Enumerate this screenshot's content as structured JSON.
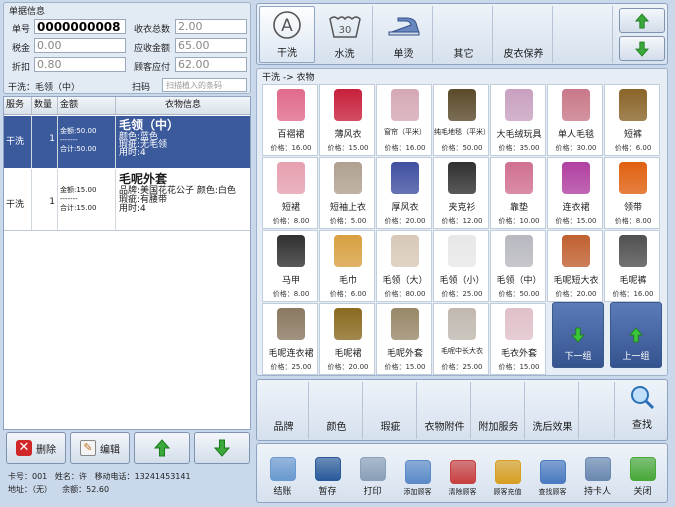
{
  "order_info": {
    "title": "单据信息",
    "order_no_label": "单号",
    "order_no": "0000000008",
    "total_label": "收衣总数",
    "total": "2.00",
    "tax_label": "税金",
    "tax": "0.00",
    "receivable_label": "应收金额",
    "receivable": "65.00",
    "discount_label": "折扣",
    "discount": "0.80",
    "payable_label": "顾客应付",
    "payable": "62.00",
    "current_item": "干洗：毛领（中）",
    "scan_label": "扫码",
    "scan_placeholder": "扫描植入的条码"
  },
  "orders": {
    "columns": [
      "服务",
      "数量",
      "金额",
      "衣物信息"
    ],
    "rows": [
      {
        "service": "干洗",
        "qty": "1",
        "amount": "金额:50.00",
        "sep": "-------",
        "subtotal": "合计:50.00",
        "name": "毛领（中）",
        "d1": "颜色:蓝色",
        "d2": "瑕疵:无毛领",
        "d3": "用时:4"
      },
      {
        "service": "干洗",
        "qty": "1",
        "amount": "金额:15.00",
        "sep": "-------",
        "subtotal": "合计:15.00",
        "name": "毛呢外套",
        "d1": "品牌:美国花花公子 颜色:白色",
        "d2": "瑕疵:有腰带",
        "d3": "用时:4"
      }
    ]
  },
  "left_buttons": {
    "delete": "删除",
    "edit": "编辑"
  },
  "footer": {
    "card_label": "卡号：",
    "card": "001",
    "name_label": "姓名：",
    "name": "许",
    "phone_label": "移动电话：",
    "phone": "13241453141",
    "address_label": "地址：",
    "address": "（无）",
    "balance_label": "余额：",
    "balance": "52.60"
  },
  "services": [
    "干洗",
    "水洗",
    "单烫",
    "其它",
    "皮衣保养"
  ],
  "breadcrumb": "干洗 -> 衣物",
  "items": [
    {
      "name": "百褶裙",
      "price": "价格：16.00",
      "color": "#e06a8c"
    },
    {
      "name": "薄风衣",
      "price": "价格：15.00",
      "color": "#c8203c"
    },
    {
      "name": "窗帘（平米）",
      "price": "价格：16.00",
      "color": "#d4a8b4"
    },
    {
      "name": "纯毛地毯（平米）",
      "price": "价格：50.00",
      "color": "#5a4a2a"
    },
    {
      "name": "大毛绒玩具",
      "price": "价格：35.00",
      "color": "#c8a0c0"
    },
    {
      "name": "单人毛毯",
      "price": "价格：30.00",
      "color": "#c87888"
    },
    {
      "name": "短裤",
      "price": "价格：6.00",
      "color": "#8a6428"
    },
    {
      "name": "短裙",
      "price": "价格：8.00",
      "color": "#e6a0b0"
    },
    {
      "name": "短袖上衣",
      "price": "价格：5.00",
      "color": "#b0a090"
    },
    {
      "name": "厚风衣",
      "price": "价格：20.00",
      "color": "#4050a0"
    },
    {
      "name": "夹克衫",
      "price": "价格：12.00",
      "color": "#303030"
    },
    {
      "name": "靠垫",
      "price": "价格：10.00",
      "color": "#d07090"
    },
    {
      "name": "连衣裙",
      "price": "价格：15.00",
      "color": "#b040a0"
    },
    {
      "name": "领带",
      "price": "价格：8.00",
      "color": "#e06010"
    },
    {
      "name": "马甲",
      "price": "价格：8.00",
      "color": "#303030"
    },
    {
      "name": "毛巾",
      "price": "价格：6.00",
      "color": "#d8a040"
    },
    {
      "name": "毛领（大）",
      "price": "价格：80.00",
      "color": "#d8c8b8"
    },
    {
      "name": "毛领（小）",
      "price": "价格：25.00",
      "color": "#e8e8e8"
    },
    {
      "name": "毛领（中）",
      "price": "价格：50.00",
      "color": "#b8b8c0"
    },
    {
      "name": "毛呢短大衣",
      "price": "价格：20.00",
      "color": "#c06030"
    },
    {
      "name": "毛呢裤",
      "price": "价格：16.00",
      "color": "#505050"
    },
    {
      "name": "毛呢连衣裙",
      "price": "价格：25.00",
      "color": "#8a7860"
    },
    {
      "name": "毛呢裙",
      "price": "价格：20.00",
      "color": "#8a6a20"
    },
    {
      "name": "毛呢外套",
      "price": "价格：15.00",
      "color": "#988868"
    },
    {
      "name": "毛呢中长大衣",
      "price": "价格：25.00",
      "color": "#c0b8b0"
    },
    {
      "name": "毛衣外套",
      "price": "价格：15.00",
      "color": "#e0c0c8"
    }
  ],
  "pager": {
    "next": "下一组",
    "prev": "上一组"
  },
  "attributes": [
    "品牌",
    "颜色",
    "瑕疵",
    "衣物附件",
    "附加服务",
    "洗后效果",
    "查找"
  ],
  "actions": [
    {
      "label": "结账",
      "name": "checkout",
      "color": "#6a9ad0"
    },
    {
      "label": "暂存",
      "name": "save-temp",
      "color": "#2a5a9a"
    },
    {
      "label": "打印",
      "name": "print",
      "color": "#8aa0b8"
    },
    {
      "label": "添加顾客",
      "name": "add-customer",
      "color": "#5a8ac8"
    },
    {
      "label": "清除顾客",
      "name": "clear-customer",
      "color": "#c84040"
    },
    {
      "label": "顾客充值",
      "name": "customer-recharge",
      "color": "#d8a020"
    },
    {
      "label": "查找顾客",
      "name": "find-customer",
      "color": "#4a7ac0"
    },
    {
      "label": "持卡人",
      "name": "cardholder",
      "color": "#6a88b0"
    },
    {
      "label": "关闭",
      "name": "close",
      "color": "#48a838"
    }
  ],
  "colors": {
    "selected_row": "#3b5a9c",
    "arrow_green": "#3aa83a"
  }
}
